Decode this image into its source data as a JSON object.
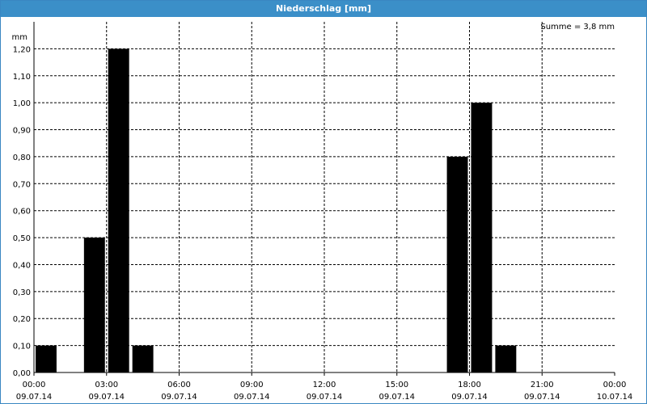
{
  "window": {
    "title": "Niederschlag [mm]"
  },
  "chart_data": {
    "type": "bar",
    "title": "Niederschlag [mm]",
    "ylabel": "mm",
    "annotation": "Summe = 3,8 mm",
    "ylim": [
      0,
      1.3
    ],
    "xlim": [
      "2014-07-09T00:00",
      "2014-07-10T00:00"
    ],
    "y_ticks": [
      "0,00",
      "0,10",
      "0,20",
      "0,30",
      "0,40",
      "0,50",
      "0,60",
      "0,70",
      "0,80",
      "0,90",
      "1,00",
      "1,10",
      "1,20"
    ],
    "x_ticks": [
      {
        "time": "00:00",
        "date": "09.07.14"
      },
      {
        "time": "03:00",
        "date": "09.07.14"
      },
      {
        "time": "06:00",
        "date": "09.07.14"
      },
      {
        "time": "09:00",
        "date": "09.07.14"
      },
      {
        "time": "12:00",
        "date": "09.07.14"
      },
      {
        "time": "15:00",
        "date": "09.07.14"
      },
      {
        "time": "18:00",
        "date": "09.07.14"
      },
      {
        "time": "21:00",
        "date": "09.07.14"
      },
      {
        "time": "00:00",
        "date": "10.07.14"
      }
    ],
    "bars": [
      {
        "start": "2014-07-09T00:00",
        "end": "2014-07-09T01:00",
        "value": 0.1
      },
      {
        "start": "2014-07-09T02:00",
        "end": "2014-07-09T03:00",
        "value": 0.5
      },
      {
        "start": "2014-07-09T03:00",
        "end": "2014-07-09T04:00",
        "value": 1.2
      },
      {
        "start": "2014-07-09T04:00",
        "end": "2014-07-09T05:00",
        "value": 0.1
      },
      {
        "start": "2014-07-09T17:00",
        "end": "2014-07-09T18:00",
        "value": 0.8
      },
      {
        "start": "2014-07-09T18:00",
        "end": "2014-07-09T19:00",
        "value": 1.0
      },
      {
        "start": "2014-07-09T19:00",
        "end": "2014-07-09T20:00",
        "value": 0.1
      }
    ],
    "grid": true,
    "bar_color": "#000000",
    "title_bar_color": "#3b8fc8"
  }
}
